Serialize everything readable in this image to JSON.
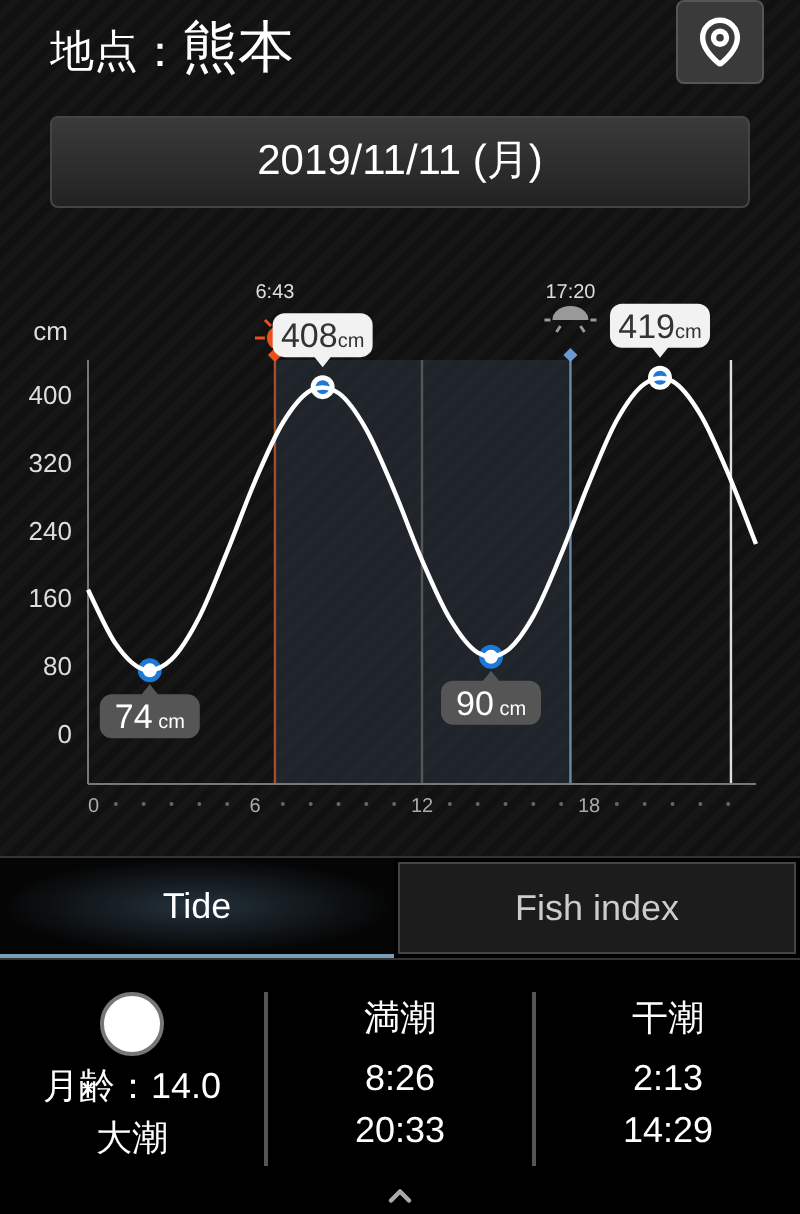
{
  "header": {
    "label": "地点：",
    "location": "熊本"
  },
  "date": "2019/11/11 (月)",
  "chart_data": {
    "type": "line",
    "ylabel": "cm",
    "x": [
      0,
      1,
      2,
      3,
      4,
      5,
      6,
      7,
      8,
      9,
      10,
      11,
      12,
      13,
      14,
      15,
      16,
      17,
      18,
      19,
      20,
      21,
      22,
      23,
      24
    ],
    "series": [
      {
        "color": "#ffffff",
        "values": [
          169,
          105,
          75,
          87,
          137,
          214,
          297,
          366,
          404,
          401,
          358,
          286,
          204,
          135,
          95,
          96,
          138,
          211,
          295,
          369,
          412,
          415,
          376,
          306,
          223
        ]
      }
    ],
    "xlim": [
      0,
      24
    ],
    "ylim": [
      -60,
      440
    ],
    "xticks": [
      0,
      6,
      12,
      18
    ],
    "yticks": [
      0,
      80,
      160,
      240,
      320,
      400
    ],
    "annotations": [
      {
        "x": 8.43,
        "y": 408,
        "text": "408cm"
      },
      {
        "x": 2.22,
        "y": 74,
        "text": "74 cm"
      },
      {
        "x": 14.48,
        "y": 90,
        "text": "90 cm"
      },
      {
        "x": 20.55,
        "y": 419,
        "text": "419cm"
      }
    ],
    "ref_lines": [
      {
        "axis": "x",
        "value": 6.7167,
        "color": "#a0502a"
      },
      {
        "axis": "x",
        "value": 17.3333,
        "color": "#6a8aa8"
      },
      {
        "axis": "x",
        "value": 12,
        "color": "#555555"
      },
      {
        "axis": "x",
        "value": 23.1,
        "color": "#dddddd"
      }
    ],
    "bands": [
      {
        "axis": "x",
        "from": 6.7167,
        "to": 17.3333,
        "color": "#2a3540"
      }
    ]
  },
  "sun_times": [
    "6:43",
    "17:20"
  ],
  "tabs": [
    {
      "label": "Tide",
      "selected": true
    },
    {
      "label": "Fish index",
      "selected": false
    }
  ],
  "moon": {
    "age": "月齢：14.0",
    "tide_name": "大潮"
  },
  "columns": [
    {
      "title": "満潮",
      "times": [
        "8:26",
        "20:33"
      ]
    },
    {
      "title": "干潮",
      "times": [
        "2:13",
        "14:29"
      ]
    }
  ]
}
